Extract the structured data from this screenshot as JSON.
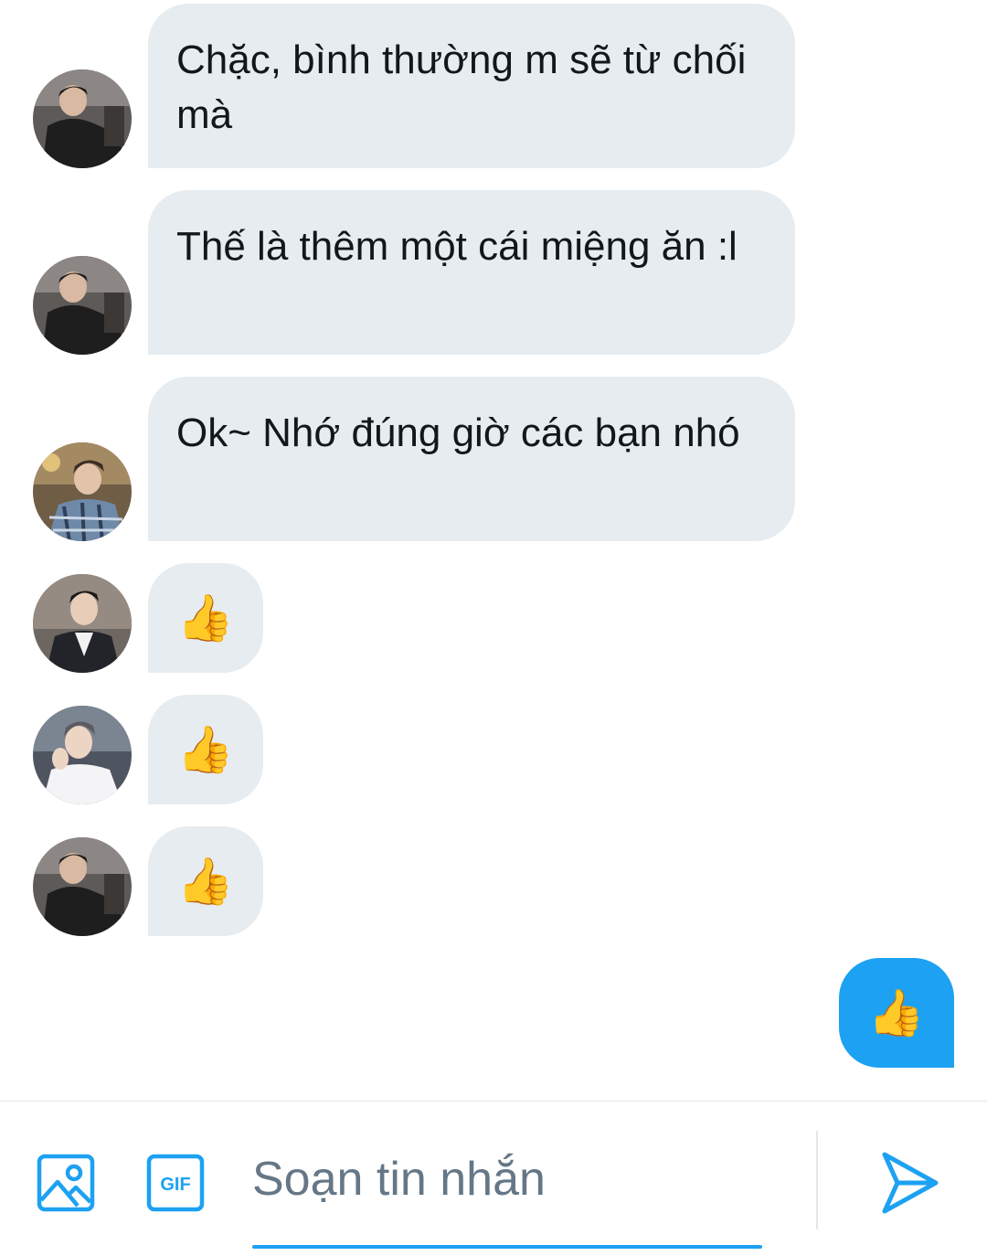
{
  "messages": [
    {
      "text": "Chặc, bình thường m sẽ từ chối mà"
    },
    {
      "text": "Thế là thêm một cái miệng ăn :l"
    },
    {
      "text": "Ok~ Nhớ đúng giờ các bạn nhó"
    },
    {
      "text": "👍"
    },
    {
      "text": "👍"
    },
    {
      "text": "👍"
    }
  ],
  "my_message": {
    "text": "👍"
  },
  "composer": {
    "placeholder": "Soạn tin nhắn",
    "gif_label": "GIF"
  },
  "colors": {
    "accent": "#1da1f2",
    "bubble_received": "#e6ecf0",
    "text": "#14171a",
    "placeholder": "#657786"
  },
  "icons": [
    "image-icon",
    "gif-icon",
    "send-icon"
  ]
}
